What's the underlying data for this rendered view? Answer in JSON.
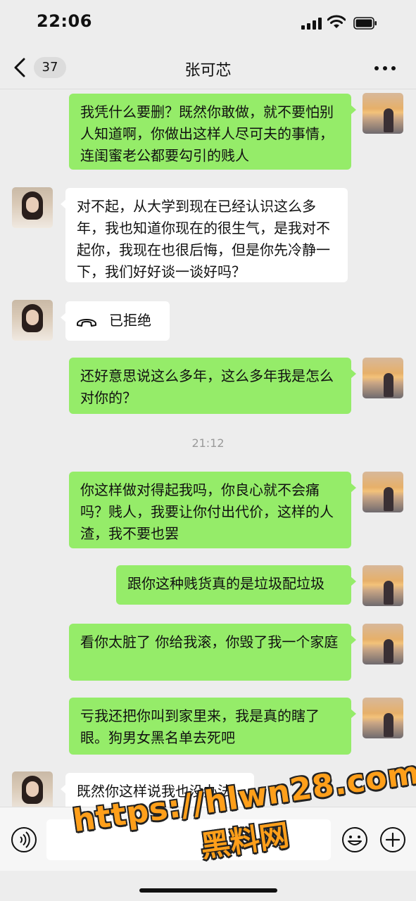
{
  "status_bar": {
    "time": "22:06"
  },
  "nav": {
    "unread_count": "37",
    "title": "张可芯"
  },
  "messages": [
    {
      "side": "me",
      "text": "我凭什么要删？既然你敢做，就不要怕别人知道啊，你做出这样人尽可夫的事情，连闺蜜老公都要勾引的贱人"
    },
    {
      "side": "other",
      "text": "对不起，从大学到现在已经认识这么多年，我也知道你现在的很生气，是我对不起你，我现在也很后悔，但是你先冷静一下，我们好好谈一谈好吗？"
    },
    {
      "side": "other",
      "type": "call",
      "text": "已拒绝"
    },
    {
      "side": "me",
      "text": "还好意思说这么多年，这么多年我是怎么对你的？"
    },
    {
      "type": "time",
      "text": "21:12"
    },
    {
      "side": "me",
      "text": "你这样做对得起我吗，你良心就不会痛吗？贱人，我要让你付出代价，这样的人渣，我不要也罢"
    },
    {
      "side": "me",
      "text": "跟你这种贱货真的是垃圾配垃圾"
    },
    {
      "side": "me",
      "text": "看你太脏了 你给我滚，你毁了我一个家庭"
    },
    {
      "side": "me",
      "text": "亏我还把你叫到家里来，我是真的瞎了眼。狗男女黑名单去死吧"
    },
    {
      "side": "other",
      "text": "既然你这样说我也没办法"
    }
  ],
  "input_bar": {
    "placeholder": ""
  },
  "watermark": {
    "url": "https://hlwn28.com",
    "brand": "黑料网"
  },
  "colors": {
    "my_bubble": "#95ec69",
    "other_bubble": "#ffffff",
    "background": "#ededed",
    "watermark": "#ff9f1a"
  },
  "icons": [
    "back-icon",
    "more-icon",
    "call-declined-icon",
    "voice-icon",
    "emoji-icon",
    "plus-icon",
    "signal-icon",
    "wifi-icon",
    "battery-icon"
  ]
}
